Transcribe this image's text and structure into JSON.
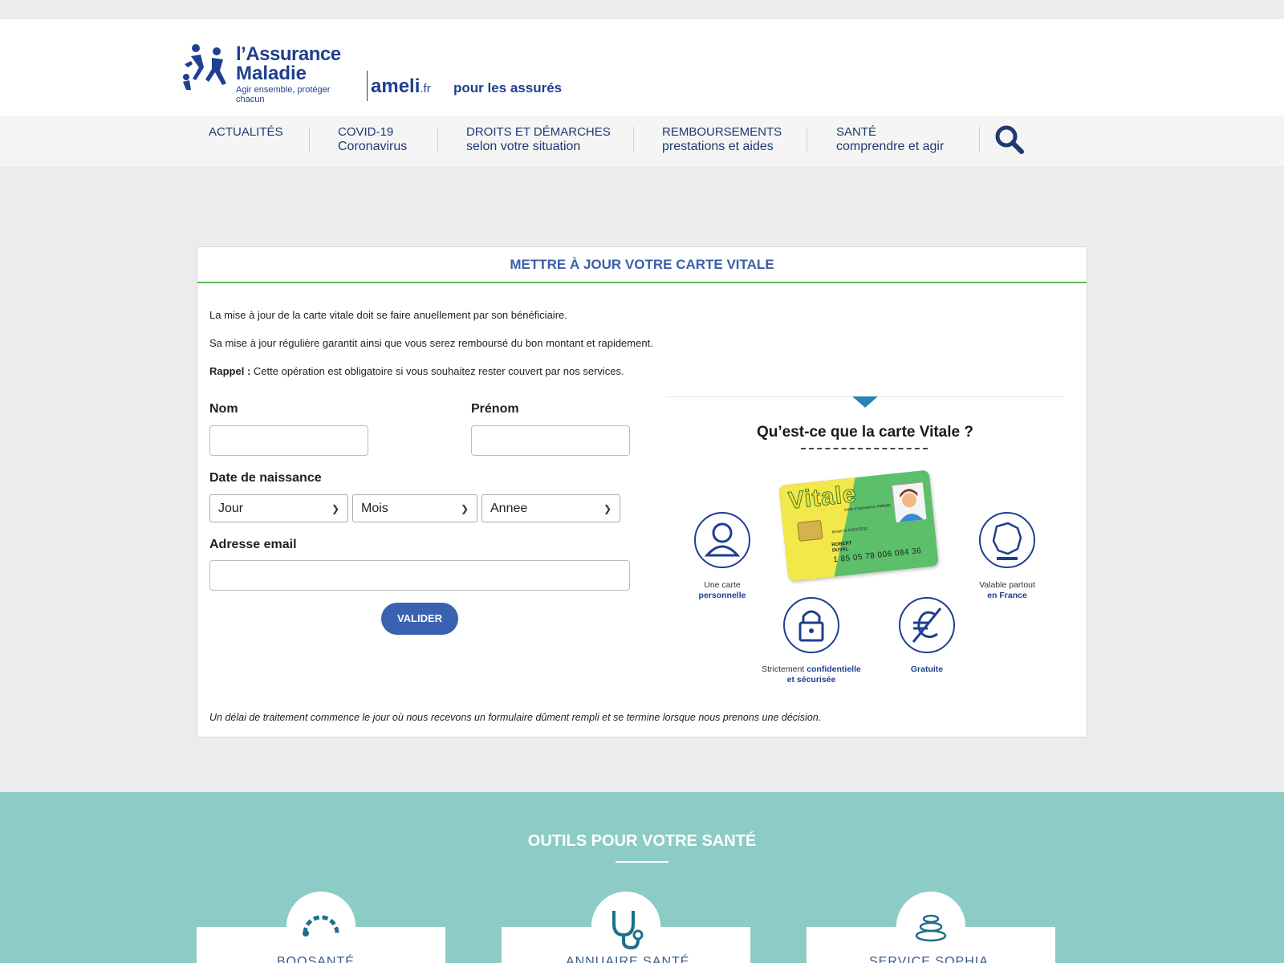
{
  "header": {
    "brand_line1": "l’Assurance",
    "brand_line2": "Maladie",
    "brand_tagline": "Agir ensemble, protéger chacun",
    "site_name": "ameli",
    "site_tld": ".fr",
    "audience": "pour les assurés"
  },
  "nav": {
    "items": [
      {
        "line1": "ACTUALITÉS",
        "line2": ""
      },
      {
        "line1": "COVID-19",
        "line2": "Coronavirus"
      },
      {
        "line1": "DROITS ET DÉMARCHES",
        "line2": "selon votre situation"
      },
      {
        "line1": "REMBOURSEMENTS",
        "line2": "prestations et aides"
      },
      {
        "line1": "SANTÉ",
        "line2": "comprendre et agir"
      }
    ],
    "search_icon": "search-icon"
  },
  "form_card": {
    "title": "METTRE À JOUR VOTRE CARTE VITALE",
    "intro1": "La mise à jour de la carte vitale doit se faire anuellement par son bénéficiaire.",
    "intro2": "Sa mise à jour régulière garantit ainsi que vous serez remboursé du bon montant et rapidement.",
    "reminder_label": "Rappel :",
    "reminder_text": " Cette opération est obligatoire si vous souhaitez rester couvert par nos services.",
    "fields": {
      "nom_label": "Nom",
      "nom_value": "",
      "prenom_label": "Prénom",
      "prenom_value": "",
      "dob_label": "Date de naissance",
      "day_selected": "Jour",
      "month_selected": "Mois",
      "year_selected": "Annee",
      "email_label": "Adresse email",
      "email_value": ""
    },
    "submit_label": "VALIDER",
    "note": "Un délai de traitement commence le jour où nous recevons un formulaire dûment rempli et se termine lorsque nous prenons une décision."
  },
  "info_panel": {
    "question": "Qu’est-ce que la carte Vitale ?",
    "card": {
      "brand": "Vitale",
      "subtitle": "carte d’assurance maladie",
      "issued": "émise le 01/01/2011",
      "name_line1": "ROBERT",
      "name_line2": "DUVAL",
      "number": "1 85 05 78 006 084 36"
    },
    "features": [
      {
        "icon": "person-icon",
        "text": "Une carte",
        "em": "personnelle"
      },
      {
        "icon": "france-map-icon",
        "text": "Valable partout",
        "em": "en France"
      },
      {
        "icon": "lock-icon",
        "text": "Strictement ",
        "em": "confidentielle",
        "em2": "et sécurisée"
      },
      {
        "icon": "no-euro-icon",
        "text": "",
        "em": "Gratuite"
      }
    ]
  },
  "footer": {
    "title": "OUTILS POUR VOTRE SANTÉ",
    "tools": [
      {
        "label": "BOOSANTÉ",
        "icon": "gauge-icon"
      },
      {
        "label": "ANNUAIRE SANTÉ",
        "icon": "stethoscope-icon"
      },
      {
        "label": "SERVICE SOPHIA",
        "icon": "stones-icon"
      }
    ]
  },
  "colors": {
    "brand_blue": "#1f3f8f",
    "title_blue": "#3a5fa7",
    "button_blue": "#3a62b0",
    "accent_green": "#5cb85c",
    "footer_teal": "#8ccbc6"
  }
}
